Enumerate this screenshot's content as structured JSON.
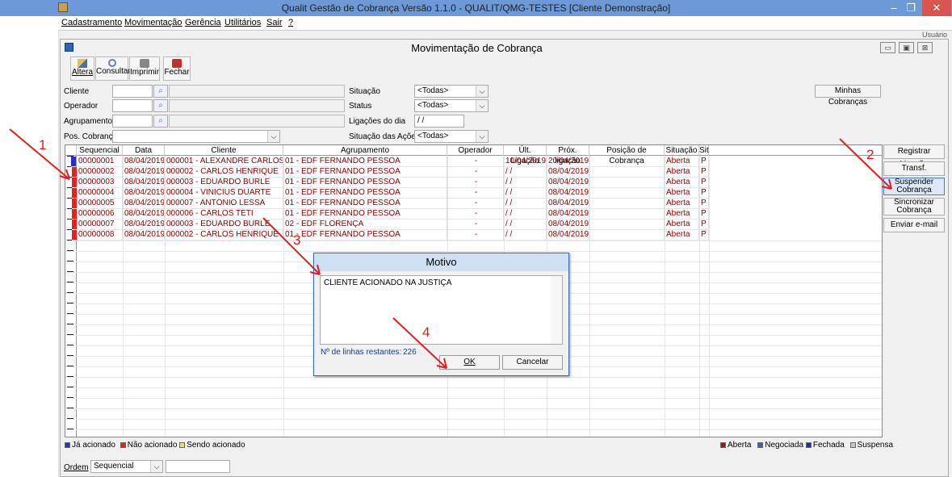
{
  "app": {
    "title": "Qualit Gestão de Cobrança Versão 1.1.0 - QUALIT/QMG-TESTES [Cliente Demonstração]",
    "window_buttons": [
      "–",
      "❐",
      "✕"
    ]
  },
  "menu": [
    "Cadastramento",
    "Movimentação",
    "Gerência",
    "Utilitários",
    "Sair",
    "?"
  ],
  "menu_right_hint": "Usuário",
  "child": {
    "title": "Movimentação de Cobrança",
    "buttons": [
      "▭",
      "▣",
      "⊠"
    ]
  },
  "toolbar": {
    "altera": "Altera",
    "consultar": "Consultar",
    "imprimir": "Imprimir",
    "fechar": "Fechar"
  },
  "filters": {
    "cliente": "Cliente",
    "operador": "Operador",
    "agrupamento": "Agrupamento",
    "pos_cobranca": "Pos. Cobrança",
    "situacao": "Situação",
    "situacao_value": "<Todas>",
    "status": "Status",
    "status_value": "<Todas>",
    "ligacoes_do_dia": "Ligações do dia",
    "ligacoes_value": " / /",
    "situacao_acoes": "Situação das Ações",
    "situacao_acoes_value": "<Todas>",
    "minhas_cobrancas": "Minhas Cobranças"
  },
  "side_buttons": {
    "registrar": "Registrar Ligação",
    "transf": "Transf. Operador",
    "suspender_1": "Suspender",
    "suspender_2": "Cobrança",
    "sincronizar_1": "Sincronizar",
    "sincronizar_2": "Cobrança",
    "email": "Enviar e-mail"
  },
  "grid": {
    "headers": {
      "seq": "Sequencial",
      "data": "Data",
      "cliente": "Cliente",
      "agrup": "Agrupamento",
      "oper": "Operador",
      "ult": "Últ. Ligação",
      "prox": "Próx. ligação",
      "pos": "Posição de Cobrança",
      "sit": "Situação",
      "sit2": "Sit"
    },
    "rows": [
      {
        "seq": "00000001",
        "data": "08/04/2019",
        "cliente": "000001 - ALEXANDRE CARLOS",
        "agrup": "01 - EDF FERNANDO PESSOA",
        "oper": "-",
        "ult": "10/04/2019",
        "prox": "20/04/2019",
        "pos": "",
        "sit": "Aberta",
        "sit2": "P"
      },
      {
        "seq": "00000002",
        "data": "08/04/2019",
        "cliente": "000002 - CARLOS HENRIQUE",
        "agrup": "01 - EDF FERNANDO PESSOA",
        "oper": "-",
        "ult": " / /",
        "prox": "08/04/2019",
        "pos": "",
        "sit": "Aberta",
        "sit2": "P"
      },
      {
        "seq": "00000003",
        "data": "08/04/2019",
        "cliente": "000003 - EDUARDO BURLE",
        "agrup": "01 - EDF FERNANDO PESSOA",
        "oper": "-",
        "ult": " / /",
        "prox": "08/04/2019",
        "pos": "",
        "sit": "Aberta",
        "sit2": "P"
      },
      {
        "seq": "00000004",
        "data": "08/04/2019",
        "cliente": "000004 - VINICIUS DUARTE",
        "agrup": "01 - EDF FERNANDO PESSOA",
        "oper": "-",
        "ult": " / /",
        "prox": "08/04/2019",
        "pos": "",
        "sit": "Aberta",
        "sit2": "P"
      },
      {
        "seq": "00000005",
        "data": "08/04/2019",
        "cliente": "000007 - ANTÔNIO LESSA",
        "agrup": "01 - EDF FERNANDO PESSOA",
        "oper": "-",
        "ult": " / /",
        "prox": "08/04/2019",
        "pos": "",
        "sit": "Aberta",
        "sit2": "P"
      },
      {
        "seq": "00000006",
        "data": "08/04/2019",
        "cliente": "000006 - CARLOS TETI",
        "agrup": "01 - EDF FERNANDO PESSOA",
        "oper": "-",
        "ult": " / /",
        "prox": "08/04/2019",
        "pos": "",
        "sit": "Aberta",
        "sit2": "P"
      },
      {
        "seq": "00000007",
        "data": "08/04/2019",
        "cliente": "000003 - EDUARDO BURLE",
        "agrup": "02 - EDF FLORENÇA",
        "oper": "-",
        "ult": " / /",
        "prox": "08/04/2019",
        "pos": "",
        "sit": "Aberta",
        "sit2": "P"
      },
      {
        "seq": "00000008",
        "data": "08/04/2019",
        "cliente": "000002 - CARLOS HENRIQUE",
        "agrup": "01 - EDF FERNANDO PESSOA",
        "oper": "-",
        "ult": " / /",
        "prox": "08/04/2019",
        "pos": "",
        "sit": "Aberta",
        "sit2": "P"
      }
    ]
  },
  "legend_left": {
    "ja": "Já acionado",
    "nao": "Não acionado",
    "sendo": "Sendo acionado"
  },
  "legend_right": {
    "aberta": "Aberta",
    "negociada": "Negociada",
    "fechada": "Fechada",
    "suspensa": "Suspensa"
  },
  "legend_colors": {
    "ja": "#2b2bd6",
    "nao": "#e82020",
    "sendo": "#f4e04a",
    "aberta": "#b01010",
    "negociada": "#3a5ad0",
    "fechada": "#1b2bc0",
    "suspensa": "#c8c8c8"
  },
  "ordem": {
    "label": "Ordem",
    "value": "Sequencial"
  },
  "dialog": {
    "title": "Motivo",
    "text": "CLIENTE ACIONADO NA JUSTIÇA",
    "lines_label": "Nº de linhas restantes:",
    "lines_value": "226",
    "ok": "OK",
    "cancel": "Cancelar"
  },
  "annotations": [
    "1",
    "2",
    "3",
    "4"
  ]
}
